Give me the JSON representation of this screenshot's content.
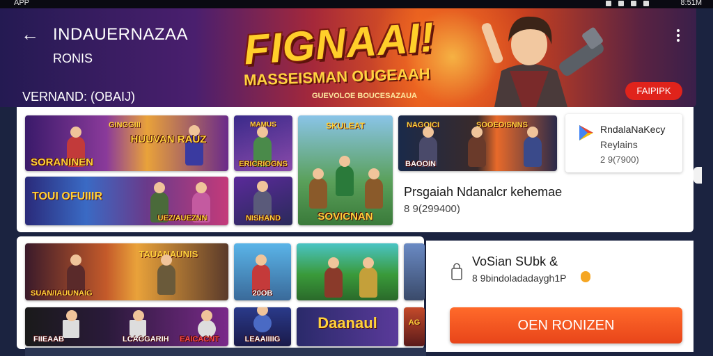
{
  "status_bar": {
    "app_label": "APP",
    "time": "8:51M"
  },
  "hero": {
    "title": "INDAUERNAZAA",
    "subtitle": "RONIS",
    "version": "VERNAND: (OBAIJ)",
    "logo_title": "FIGNAAI!",
    "logo_tagline": "MASSEISMAN OUGEAAH",
    "logo_small": "GUEVOLOE BOUCESAZAUA",
    "badge_label": "FAIPIPK"
  },
  "featured_tiles": [
    {
      "caption": "SORANINEN",
      "header": "GINGGIII"
    },
    {
      "caption": "",
      "header": "HUUVAN   RAUZ"
    },
    {
      "caption": "ERICRIOGNS",
      "header": "MAMUS"
    },
    {
      "caption": "SOVICNAN",
      "header": "SKULEAT"
    },
    {
      "caption": "BAOOIN",
      "header": "NAGOICI"
    },
    {
      "caption": "",
      "header": "SOOEOISNNS"
    },
    {
      "caption": "UEZ/AUEZNN",
      "header": "TOUI OFUIIIR"
    },
    {
      "caption": "",
      "header": ""
    },
    {
      "caption": "NISHAND",
      "header": ""
    }
  ],
  "related_app": {
    "name": "RndalaNaKecy",
    "meta": "Reylains",
    "count": "2 9(7900)"
  },
  "program": {
    "title": "Prsgaiah Ndanalcr kehemae",
    "size": "8 9(299400)"
  },
  "lower_tiles": [
    {
      "caption": "SUAN/IAUUNAIG",
      "header": "TAUANAUNIS"
    },
    {
      "caption": "20OB",
      "header": ""
    },
    {
      "caption": "",
      "header": ""
    },
    {
      "caption": "LEAAIIIIG",
      "header": ""
    },
    {
      "caption": "FIIEAAB",
      "header": ""
    },
    {
      "caption": "LCAGGARIH",
      "header": ""
    },
    {
      "caption": "EAICACNT",
      "header": ""
    },
    {
      "caption": "",
      "header": ""
    },
    {
      "caption": "",
      "header": "Daanaul"
    },
    {
      "caption": "",
      "header": "AG"
    }
  ],
  "install": {
    "version_label": "VoSian SUbk &",
    "version_detail": "8 9bindoladadaygh1P",
    "button_label": "OEN RONIZEN"
  },
  "colors": {
    "accent": "#e8451a",
    "badge": "#e0231b",
    "logo_yellow": "#ffcf2a"
  },
  "icons": [
    "arrow-back-icon",
    "more-vertical-icon",
    "play-store-icon",
    "lock-icon"
  ]
}
